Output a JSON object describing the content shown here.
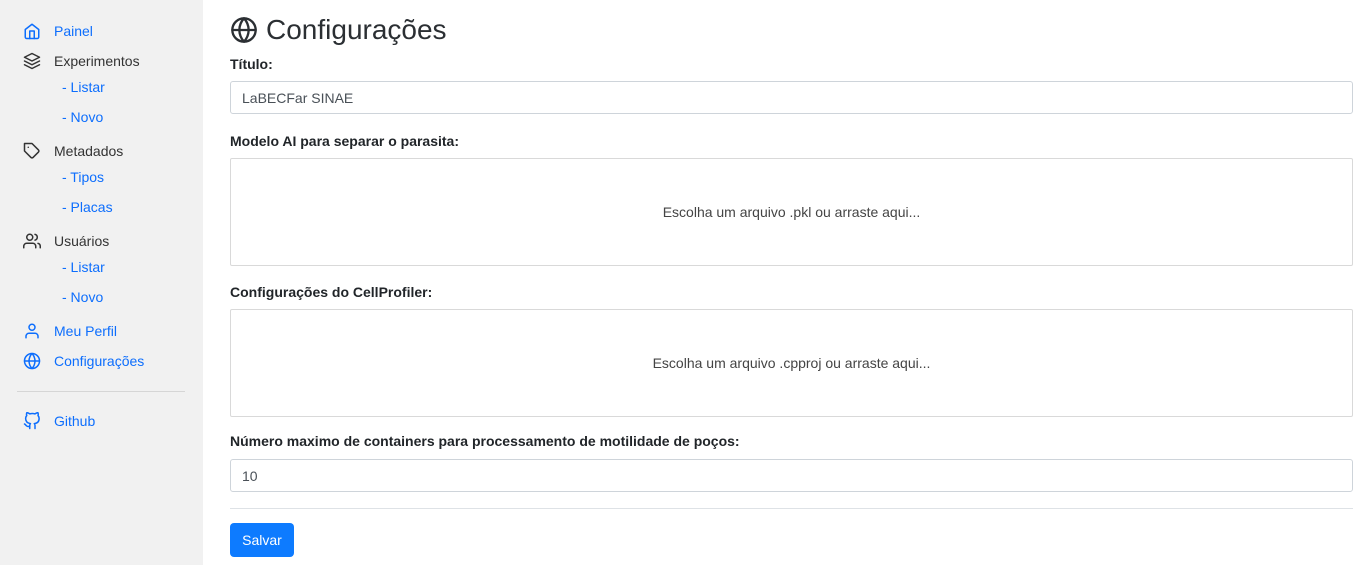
{
  "sidebar": {
    "painel": "Painel",
    "experimentos": "Experimentos",
    "experimentos_listar": "- Listar",
    "experimentos_novo": "- Novo",
    "metadados": "Metadados",
    "metadados_tipos": "- Tipos",
    "metadados_placas": "- Placas",
    "usuarios": "Usuários",
    "usuarios_listar": "- Listar",
    "usuarios_novo": "- Novo",
    "meu_perfil": "Meu Perfil",
    "configuracoes": "Configurações",
    "github": "Github"
  },
  "main": {
    "title": "Configurações",
    "titulo_label": "Título:",
    "titulo_value": "LaBECFar SINAE",
    "modelo_label": "Modelo AI para separar o parasita:",
    "modelo_dropzone": "Escolha um arquivo .pkl ou arraste aqui...",
    "cellprofiler_label": "Configurações do CellProfiler:",
    "cellprofiler_dropzone": "Escolha um arquivo .cpproj ou arraste aqui...",
    "containers_label": "Número maximo de containers para processamento de motilidade de poços:",
    "containers_value": "10",
    "save_label": "Salvar"
  },
  "colors": {
    "accent": "#0d7bff",
    "link": "#0d6efd",
    "sidebar_bg": "#f1f1f1"
  }
}
